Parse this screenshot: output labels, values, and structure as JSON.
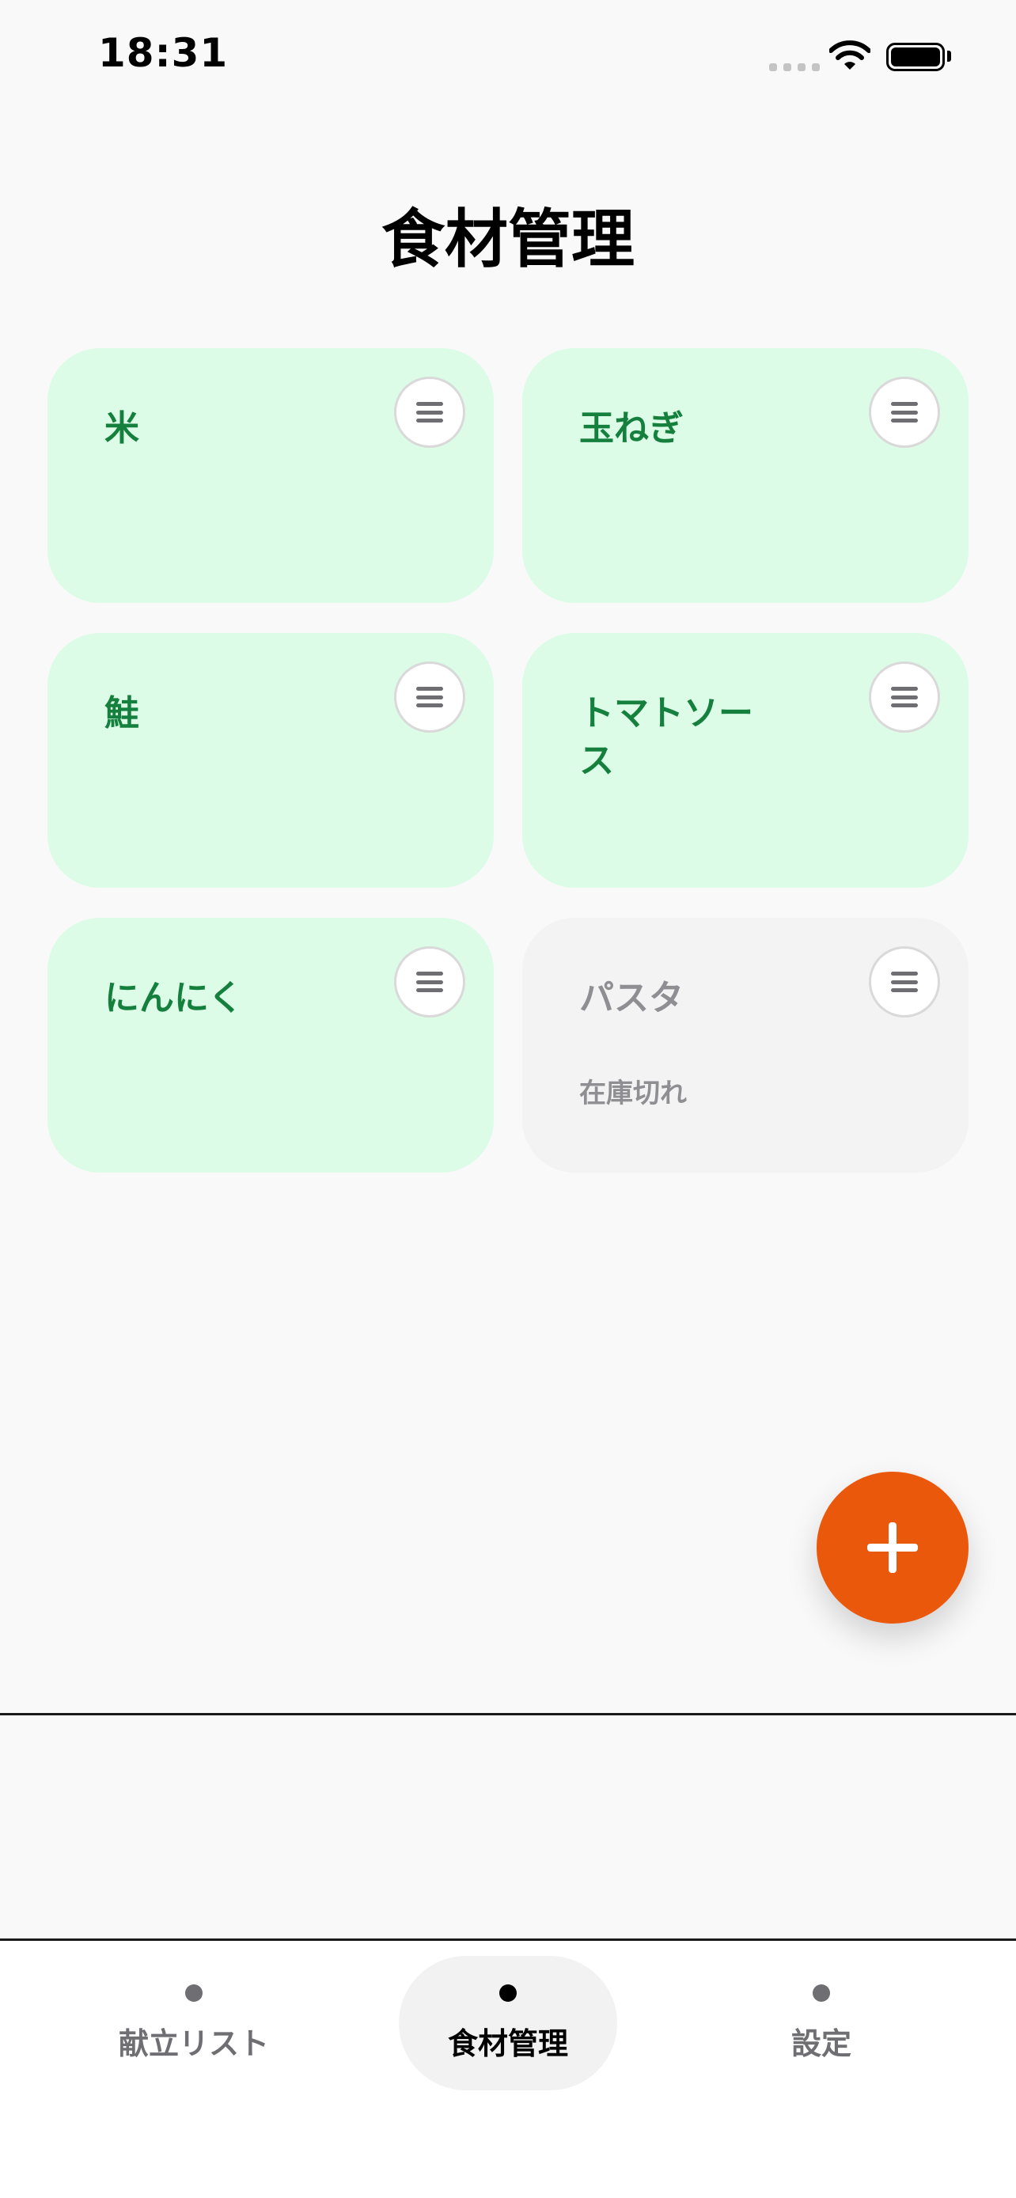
{
  "status_bar": {
    "time": "18:31"
  },
  "header": {
    "title": "食材管理"
  },
  "ingredients": [
    {
      "name": "米",
      "status": ""
    },
    {
      "name": "玉ねぎ",
      "status": ""
    },
    {
      "name": "鮭",
      "status": ""
    },
    {
      "name": "トマトソース",
      "status": ""
    },
    {
      "name": "にんにく",
      "status": ""
    },
    {
      "name": "パスタ",
      "status": "在庫切れ"
    }
  ],
  "fab": {
    "icon": "plus-icon"
  },
  "tabs": [
    {
      "label": "献立リスト",
      "active": false
    },
    {
      "label": "食材管理",
      "active": true
    },
    {
      "label": "設定",
      "active": false
    }
  ],
  "colors": {
    "in_stock_bg": "#dcfce7",
    "in_stock_text": "#15803d",
    "out_of_stock_bg": "#f3f3f3",
    "fab": "#ea580c"
  }
}
